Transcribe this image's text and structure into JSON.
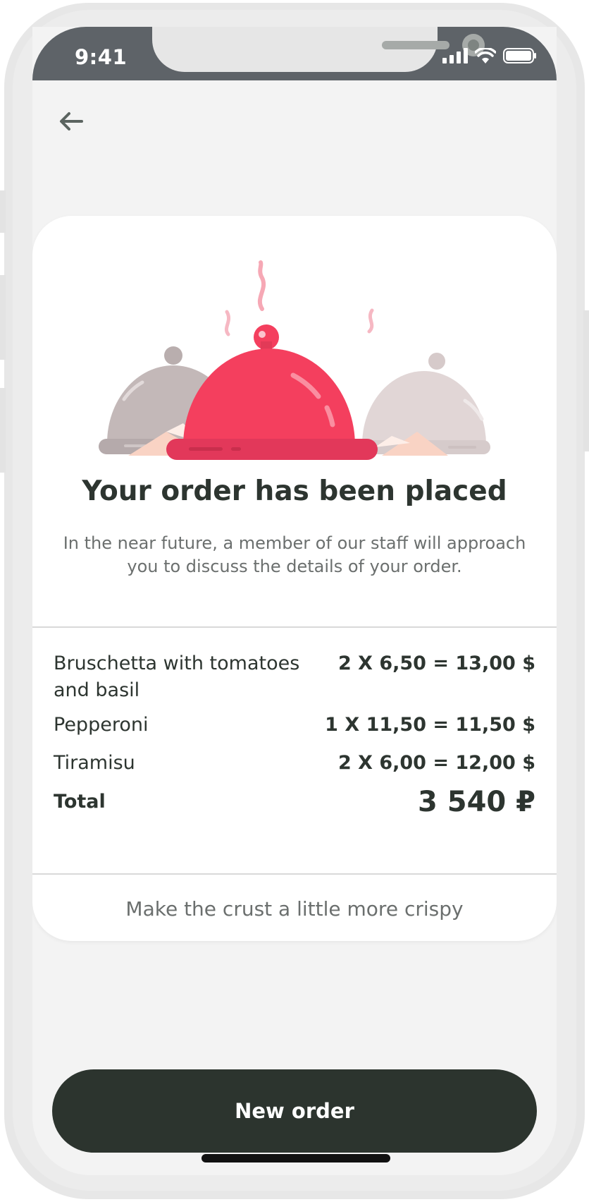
{
  "status_bar": {
    "time": "9:41"
  },
  "order": {
    "title": "Your order has been placed",
    "subtitle": "In the near future, a member of our staff will approach you to discuss the details of your order.",
    "items": [
      {
        "name": "Bruschetta with tomatoes and basil",
        "price": "2 X 6,50 = 13,00 $"
      },
      {
        "name": "Pepperoni",
        "price": "1 X 11,50 = 11,50 $"
      },
      {
        "name": "Tiramisu",
        "price": "2 X 6,00 = 12,00 $"
      }
    ],
    "total_label": "Total",
    "total_value": "3 540 ₽",
    "comment": "Make the crust a little more crispy"
  },
  "actions": {
    "new_order_label": "New order"
  },
  "colors": {
    "primary_button": "#2c342e",
    "accent_cloche": "#f43f5e",
    "status_bar": "#5e6368"
  },
  "icons": {
    "back": "arrow-left-icon",
    "signal": "cellular-signal-icon",
    "wifi": "wifi-icon",
    "battery": "battery-icon"
  }
}
